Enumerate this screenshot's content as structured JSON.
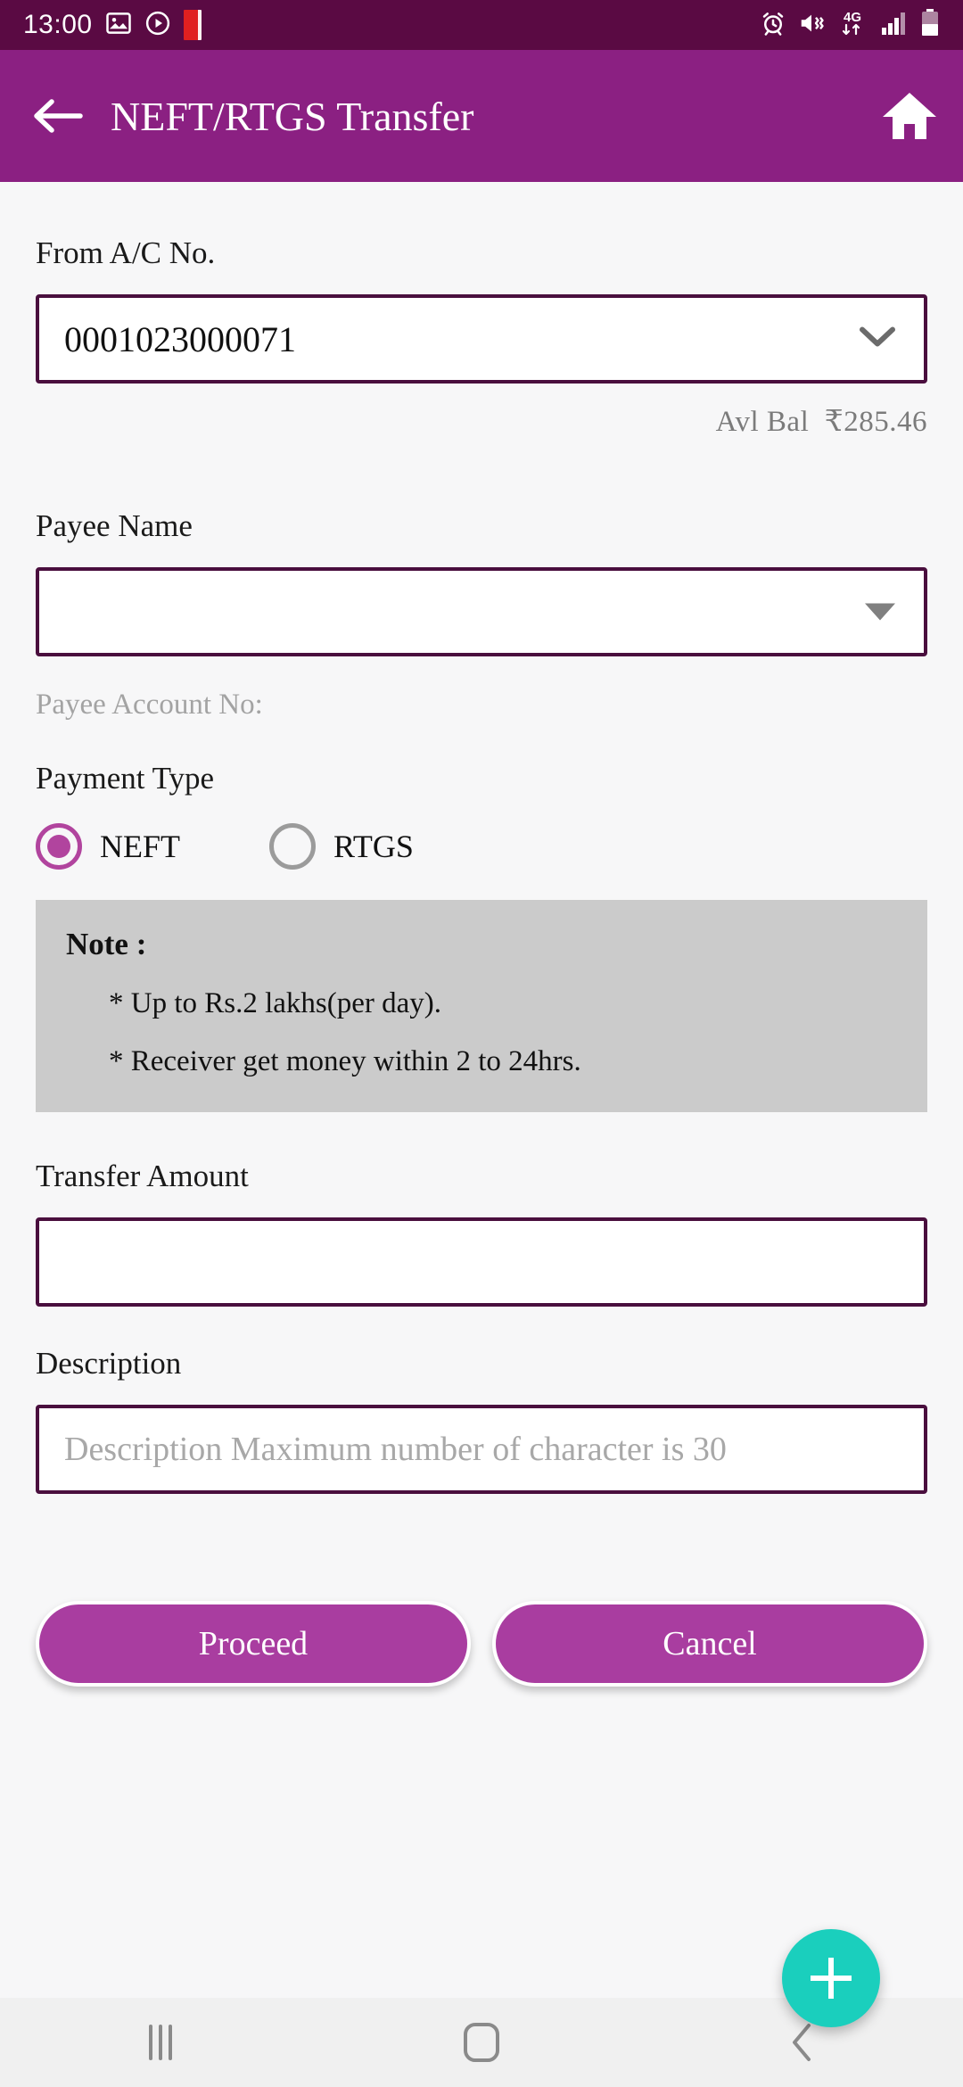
{
  "status_bar": {
    "time": "13:00",
    "left_icons": [
      "gallery-icon",
      "play-circle-icon",
      "red-app-icon"
    ],
    "right_icons": [
      "alarm-icon",
      "mute-vibrate-icon",
      "4g-data-icon",
      "signal-icon",
      "battery-icon"
    ],
    "network_label": "4G",
    "background_color": "#5a0a43"
  },
  "app_bar": {
    "title": "NEFT/RTGS Transfer",
    "back_icon": "arrow-left-icon",
    "home_icon": "home-icon",
    "background_color": "#8b2082"
  },
  "form": {
    "from_account": {
      "label": "From A/C No.",
      "value": "0001023000071",
      "dropdown_icon": "chevron-down-icon"
    },
    "available_balance": {
      "label": "Avl Bal",
      "amount": "₹285.46"
    },
    "payee_name": {
      "label": "Payee Name",
      "value": "",
      "placeholder": "",
      "dropdown_icon": "triangle-down-icon"
    },
    "payee_account": {
      "label": "Payee Account No:"
    },
    "payment_type": {
      "label": "Payment Type",
      "options": [
        {
          "label": "NEFT",
          "selected": true
        },
        {
          "label": "RTGS",
          "selected": false
        }
      ],
      "selected_color": "#b1449e"
    },
    "note": {
      "title": "Note :",
      "lines": [
        "* Up to Rs.2 lakhs(per day).",
        "* Receiver get money within 2 to 24hrs."
      ],
      "background_color": "#cbcbcb"
    },
    "transfer_amount": {
      "label": "Transfer Amount",
      "value": "",
      "placeholder": ""
    },
    "description": {
      "label": "Description",
      "value": "",
      "placeholder": "Description Maximum number of character is 30"
    }
  },
  "actions": {
    "proceed_label": "Proceed",
    "cancel_label": "Cancel",
    "button_color": "#a93da0",
    "fab": {
      "icon": "plus-icon",
      "color": "#1acfbd"
    }
  },
  "nav_bar": {
    "recents_icon": "recents-icon",
    "home_icon": "home-square-icon",
    "back_icon": "chevron-left-icon"
  }
}
